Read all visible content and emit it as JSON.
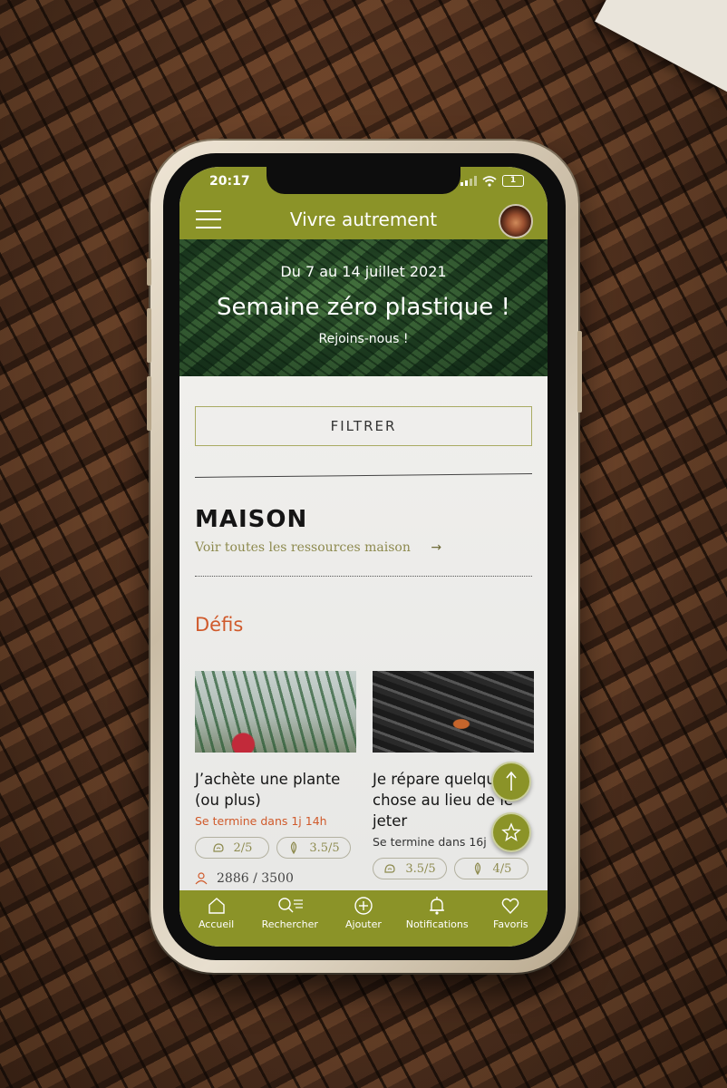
{
  "colors": {
    "accent": "#8b9328",
    "highlight": "#d05a2b"
  },
  "status_bar": {
    "time": "20:17",
    "battery": "1"
  },
  "app_bar": {
    "title": "Vivre autrement",
    "menu_icon": "hamburger-icon",
    "avatar": "user-avatar"
  },
  "hero": {
    "dates": "Du 7 au 14 juillet 2021",
    "headline": "Semaine zéro plastique !",
    "subtitle": "Rejoins-nous !"
  },
  "filter_label": "FILTRER",
  "section": {
    "title": "MAISON",
    "see_all": "Voir toutes les ressources maison",
    "see_all_arrow": "→",
    "subsection": "Défis"
  },
  "cards": [
    {
      "title_line1": "J’achète une plante",
      "title_line2": "(ou plus)",
      "ends": "Se termine dans 1j 14h",
      "difficulty": "2/5",
      "impact": "3.5/5",
      "participants": "2886 / 3500"
    },
    {
      "title_line1": "Je répare quelque",
      "title_line2": "chose au lieu de le",
      "title_line3": "jeter",
      "ends": "Se termine dans 16j",
      "difficulty": "3.5/5",
      "impact": "4/5"
    }
  ],
  "tabs": [
    {
      "label": "Accueil",
      "icon": "home-icon"
    },
    {
      "label": "Rechercher",
      "icon": "search-icon"
    },
    {
      "label": "Ajouter",
      "icon": "add-icon"
    },
    {
      "label": "Notifications",
      "icon": "bell-icon"
    },
    {
      "label": "Favoris",
      "icon": "heart-icon"
    }
  ]
}
